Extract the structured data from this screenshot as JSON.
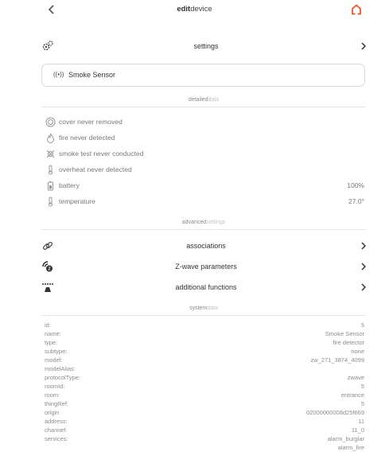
{
  "header": {
    "title_bold": "edit",
    "title_rest": "device"
  },
  "settings_row": {
    "label": "settings"
  },
  "sensor": {
    "icon_glyph": "((•))",
    "name": "Smoke Sensor"
  },
  "sections": {
    "detailed": {
      "bold": "detailed",
      "light": "data"
    },
    "advanced": {
      "bold": "advanced",
      "light": "settings"
    },
    "system": {
      "bold": "system",
      "light": "data"
    }
  },
  "detailed_data": [
    {
      "icon": "cover-icon",
      "label": "cover never removed",
      "value": ""
    },
    {
      "icon": "fire-icon",
      "label": "fire never detected",
      "value": ""
    },
    {
      "icon": "smoke-test-icon",
      "label": "smoke test never conducted",
      "value": ""
    },
    {
      "icon": "thermometer-icon",
      "label": "overheat never detected",
      "value": ""
    },
    {
      "icon": "battery-icon",
      "label": "battery",
      "value": "100%"
    },
    {
      "icon": "thermometer-icon",
      "label": "temperature",
      "value": "27.0°"
    }
  ],
  "advanced_settings": [
    {
      "icon": "link-icon",
      "label": "associations"
    },
    {
      "icon": "zwave-icon",
      "label": "Z-wave parameters"
    },
    {
      "icon": "functions-icon",
      "label": "additional functions"
    }
  ],
  "system_data": [
    {
      "key": "id:",
      "value": "5"
    },
    {
      "key": "name:",
      "value": "Smoke Sensor"
    },
    {
      "key": "type:",
      "value": "fire detector"
    },
    {
      "key": "subtype:",
      "value": "none"
    },
    {
      "key": "model:",
      "value": "zw_271_3874_4099"
    },
    {
      "key": "modelAlias:",
      "value": ""
    },
    {
      "key": "protocolType:",
      "value": "zwave"
    },
    {
      "key": "roomId:",
      "value": "5"
    },
    {
      "key": "room:",
      "value": "entrance"
    },
    {
      "key": "thingRef:",
      "value": "5"
    },
    {
      "key": "origin",
      "value": "02000000008d25f669"
    },
    {
      "key": "address:",
      "value": "11"
    },
    {
      "key": "channel:",
      "value": "11_0"
    },
    {
      "key": "services:",
      "value": "alarm_burglar"
    },
    {
      "key": "",
      "value": "alarm_fire"
    }
  ],
  "colors": {
    "accent": "#e8542e",
    "text": "#333333",
    "muted": "#8c8c8c",
    "divider": "#e6e6e6"
  }
}
